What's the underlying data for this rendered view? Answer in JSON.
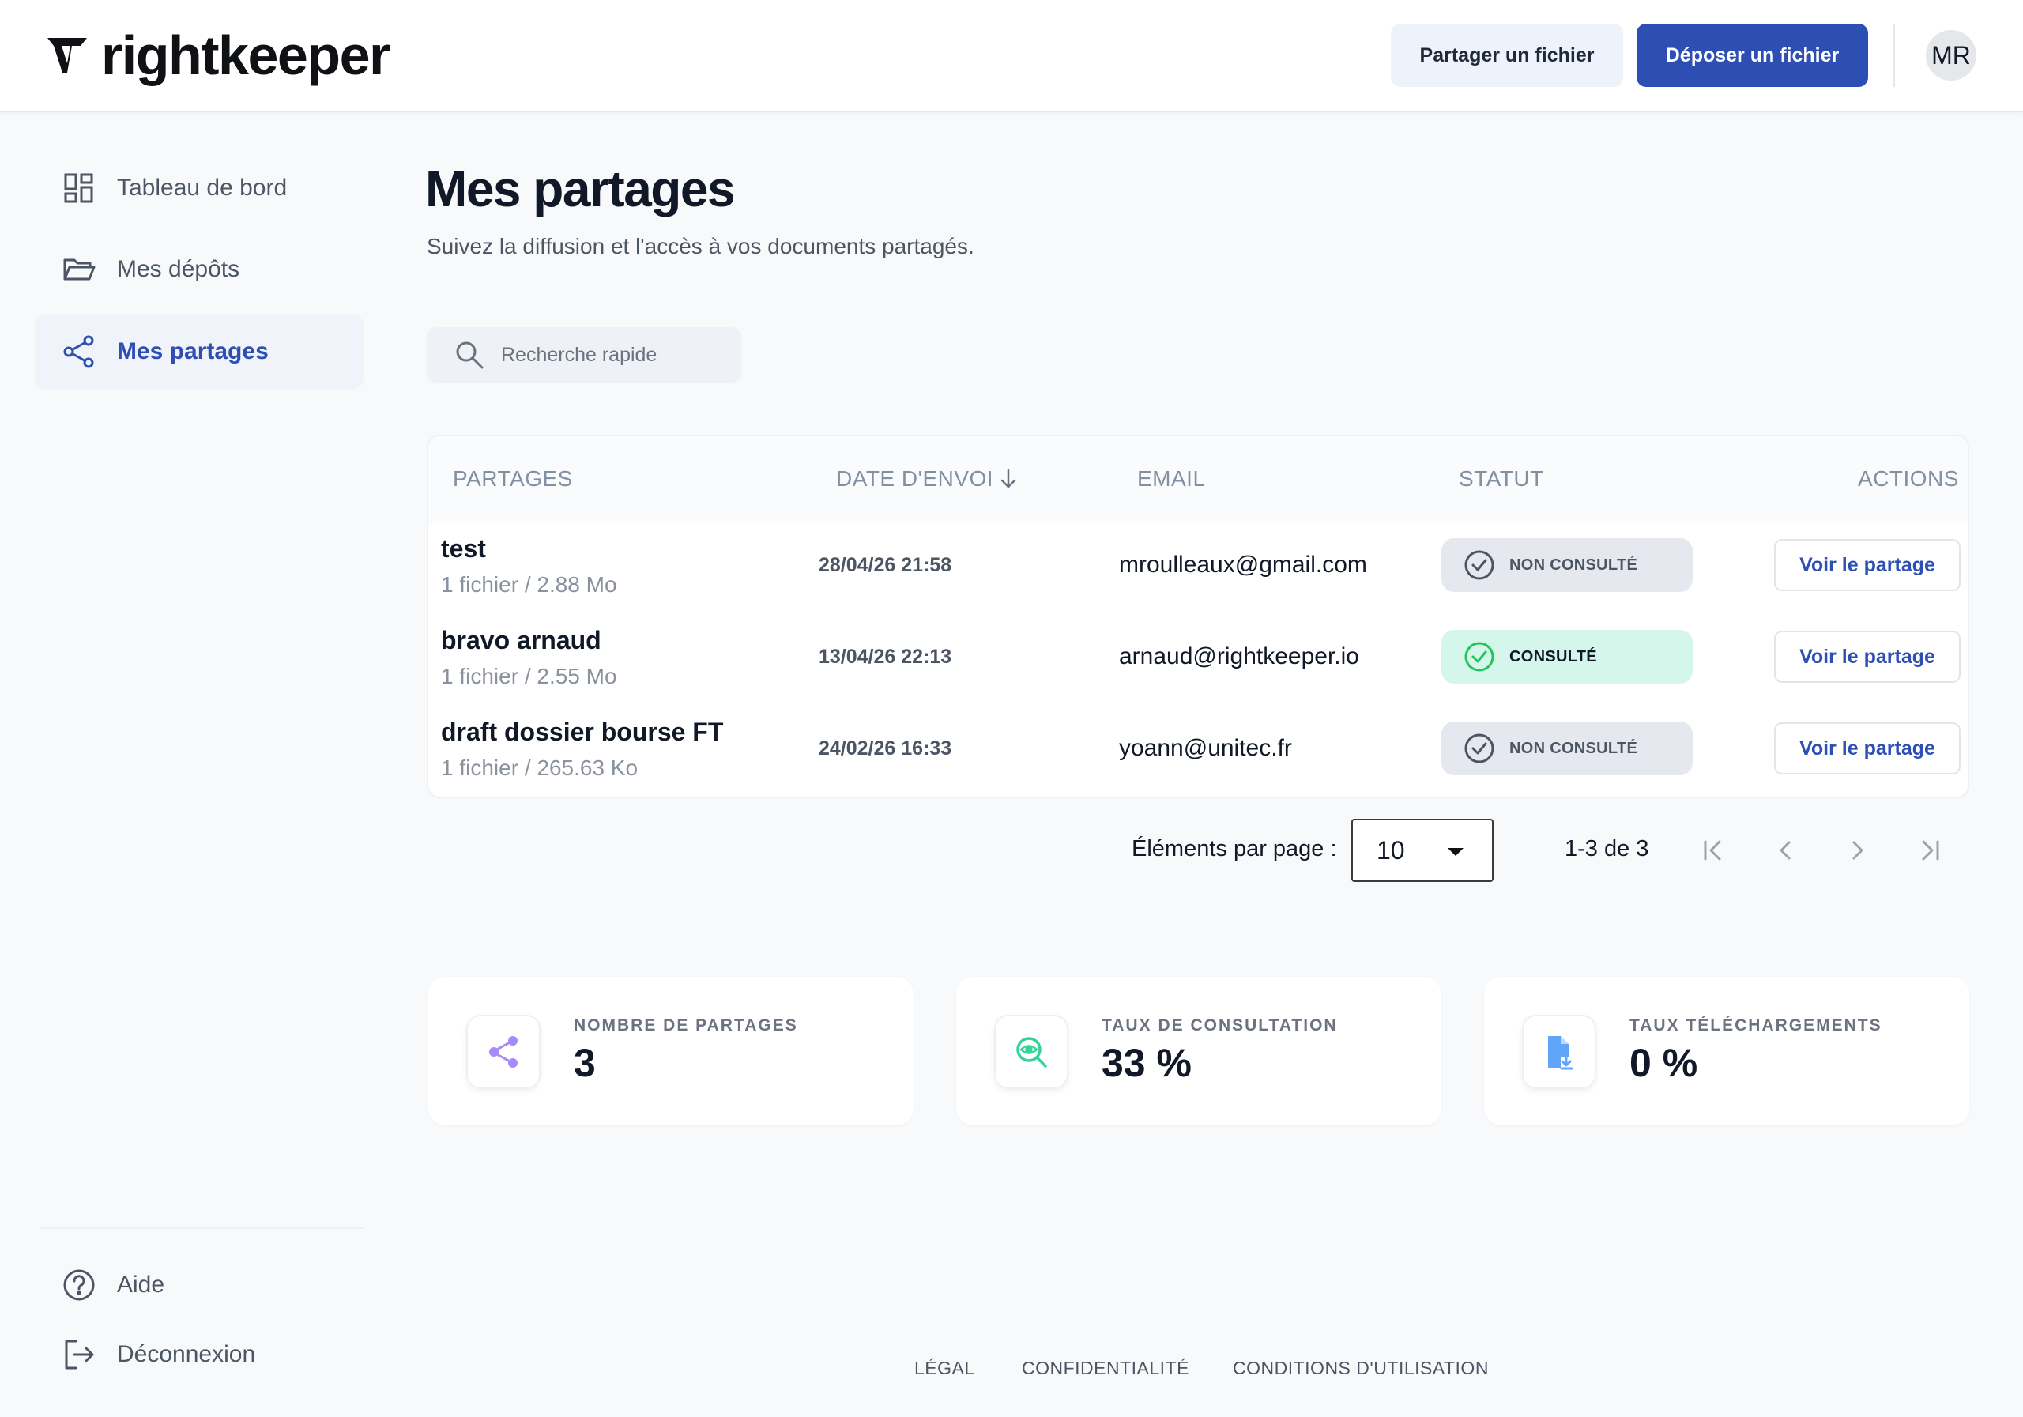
{
  "header": {
    "logo_text": "rightkeeper",
    "share_button": "Partager un fichier",
    "upload_button": "Déposer un fichier",
    "avatar_initials": "MR",
    "accent_color": "#2d4fb4"
  },
  "sidebar": {
    "items": [
      {
        "label": "Tableau de bord",
        "icon": "dashboard-icon",
        "active": false
      },
      {
        "label": "Mes dépôts",
        "icon": "folder-open-icon",
        "active": false
      },
      {
        "label": "Mes partages",
        "icon": "share-icon",
        "active": true
      }
    ],
    "bottom": [
      {
        "label": "Aide",
        "icon": "help-icon"
      },
      {
        "label": "Déconnexion",
        "icon": "logout-icon"
      }
    ]
  },
  "main": {
    "title": "Mes partages",
    "subtitle": "Suivez la diffusion et l'accès à vos documents partagés.",
    "search_placeholder": "Recherche rapide"
  },
  "table": {
    "columns": [
      "PARTAGES",
      "DATE D'ENVOI",
      "EMAIL",
      "STATUT",
      "ACTIONS"
    ],
    "sort_column": "DATE D'ENVOI",
    "sort_direction": "desc",
    "rows": [
      {
        "name": "test",
        "size": "1 fichier / 2.88 Mo",
        "date": "28/04/26 21:58",
        "email": "mroulleaux@gmail.com",
        "status": "NON CONSULTÉ",
        "consulted": false,
        "action": "Voir le partage"
      },
      {
        "name": "bravo arnaud",
        "size": "1 fichier / 2.55 Mo",
        "date": "13/04/26 22:13",
        "email": "arnaud@rightkeeper.io",
        "status": "CONSULTÉ",
        "consulted": true,
        "action": "Voir le partage"
      },
      {
        "name": "draft dossier bourse FT",
        "size": "1 fichier / 265.63 Ko",
        "date": "24/02/26 16:33",
        "email": "yoann@unitec.fr",
        "status": "NON CONSULTÉ",
        "consulted": false,
        "action": "Voir le partage"
      }
    ]
  },
  "pagination": {
    "label": "Éléments par page :",
    "page_size": "10",
    "range": "1-3 de 3"
  },
  "stats": [
    {
      "label": "NOMBRE DE PARTAGES",
      "value": "3",
      "icon": "share-icon",
      "color": "#a78bfa"
    },
    {
      "label": "TAUX DE CONSULTATION",
      "value": "33 %",
      "icon": "eye-search-icon",
      "color": "#34d399"
    },
    {
      "label": "TAUX TÉLÉCHARGEMENTS",
      "value": "0 %",
      "icon": "file-download-icon",
      "color": "#60a5fa"
    }
  ],
  "footer": {
    "links": [
      "LÉGAL",
      "CONFIDENTIALITÉ",
      "CONDITIONS D'UTILISATION"
    ]
  }
}
